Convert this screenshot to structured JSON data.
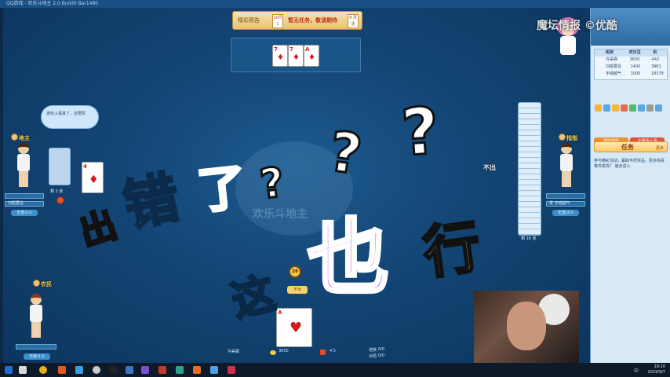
{
  "window": {
    "titlebar_text": "QQ游戏 - 欢乐斗地主 2.0  Build0  Bar1480"
  },
  "banner": {
    "left_label": "精彩预告",
    "day_box": "10月\n1",
    "notice": "暂无任务，敬请期待",
    "right_box": "9\n月活"
  },
  "watermark": {
    "text": "欢乐斗地主"
  },
  "played_cards": [
    {
      "rank": "7",
      "suit": "♦"
    },
    {
      "rank": "7",
      "suit": "♦"
    },
    {
      "rank": "A",
      "suit": "♦"
    }
  ],
  "players": {
    "left": {
      "role": "地主",
      "name": "刘冕要总",
      "button": "无道斗斗",
      "cards_left": "剩 2 张",
      "card_shown": {
        "rank": "4",
        "suit": "♦"
      },
      "chat": "游戏斗语真了，这要赞"
    },
    "right": {
      "role": "指指",
      "name": "零 宇城越气",
      "button": "无道斗斗",
      "cards_left": "剩 16 张",
      "action": "不出"
    },
    "bottom": {
      "role": "农民",
      "button": "无道斗斗",
      "card_shown": {
        "rank": "A",
        "suit": "♥"
      },
      "timer": "26",
      "tag": "不出"
    }
  },
  "bottom_info": {
    "name": "许昊霖",
    "coins": "3650",
    "score": "4 5",
    "multiplier_label": "倍数",
    "multiplier_value": "0/0",
    "level_label": "对局",
    "level_value": "0/0"
  },
  "side_panel": {
    "watermark": "魔坛情报 ©优酷",
    "rank_headers": [
      "昵称",
      "欢乐豆",
      "积"
    ],
    "rank_rows": [
      [
        "许昊霖",
        "3650",
        "-442"
      ],
      [
        "刘冕要总",
        "1400",
        "3981"
      ],
      [
        "宇城越气",
        "1005",
        "18378"
      ]
    ],
    "buttons": [
      "领取奖励",
      "比赛场入场"
    ],
    "task_label": "任务",
    "task_small": "更多",
    "note": "参与精彩活动，赢取丰厚奖品，更多惊喜等你发现！ 速去进入"
  },
  "stickers": {
    "out": "出",
    "wrong": "错",
    "le": "了",
    "q": "?",
    "zhe": "这",
    "ye": "也",
    "xing": "行"
  },
  "taskbar": {
    "tray_text": "中",
    "time": "19:10",
    "date": "2019/9/7"
  },
  "colors": {
    "table": "#134574",
    "panel": "#d7e8f6",
    "accent_blue": "#25a3ea",
    "accent_purple": "#a52ee6",
    "card_red": "#d21d1d"
  }
}
